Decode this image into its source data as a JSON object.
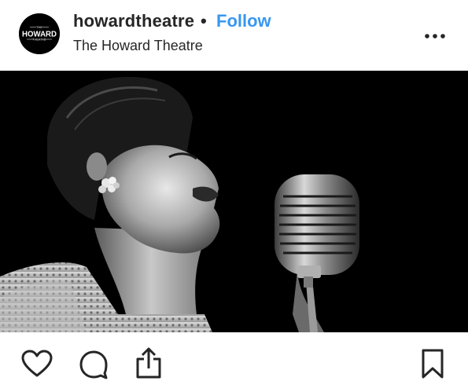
{
  "post": {
    "username": "howardtheatre",
    "separator": "•",
    "follow_label": "Follow",
    "location": "The Howard Theatre",
    "avatar": {
      "logo_text": "HOWARD",
      "logo_top": "THE",
      "logo_bottom": "THEATRE"
    }
  },
  "icons": {
    "more": "more-options-icon",
    "like": "heart-icon",
    "comment": "comment-icon",
    "share": "share-icon",
    "save": "bookmark-icon"
  },
  "colors": {
    "follow": "#3897f0",
    "text": "#262626",
    "photo_background": "#000000"
  }
}
